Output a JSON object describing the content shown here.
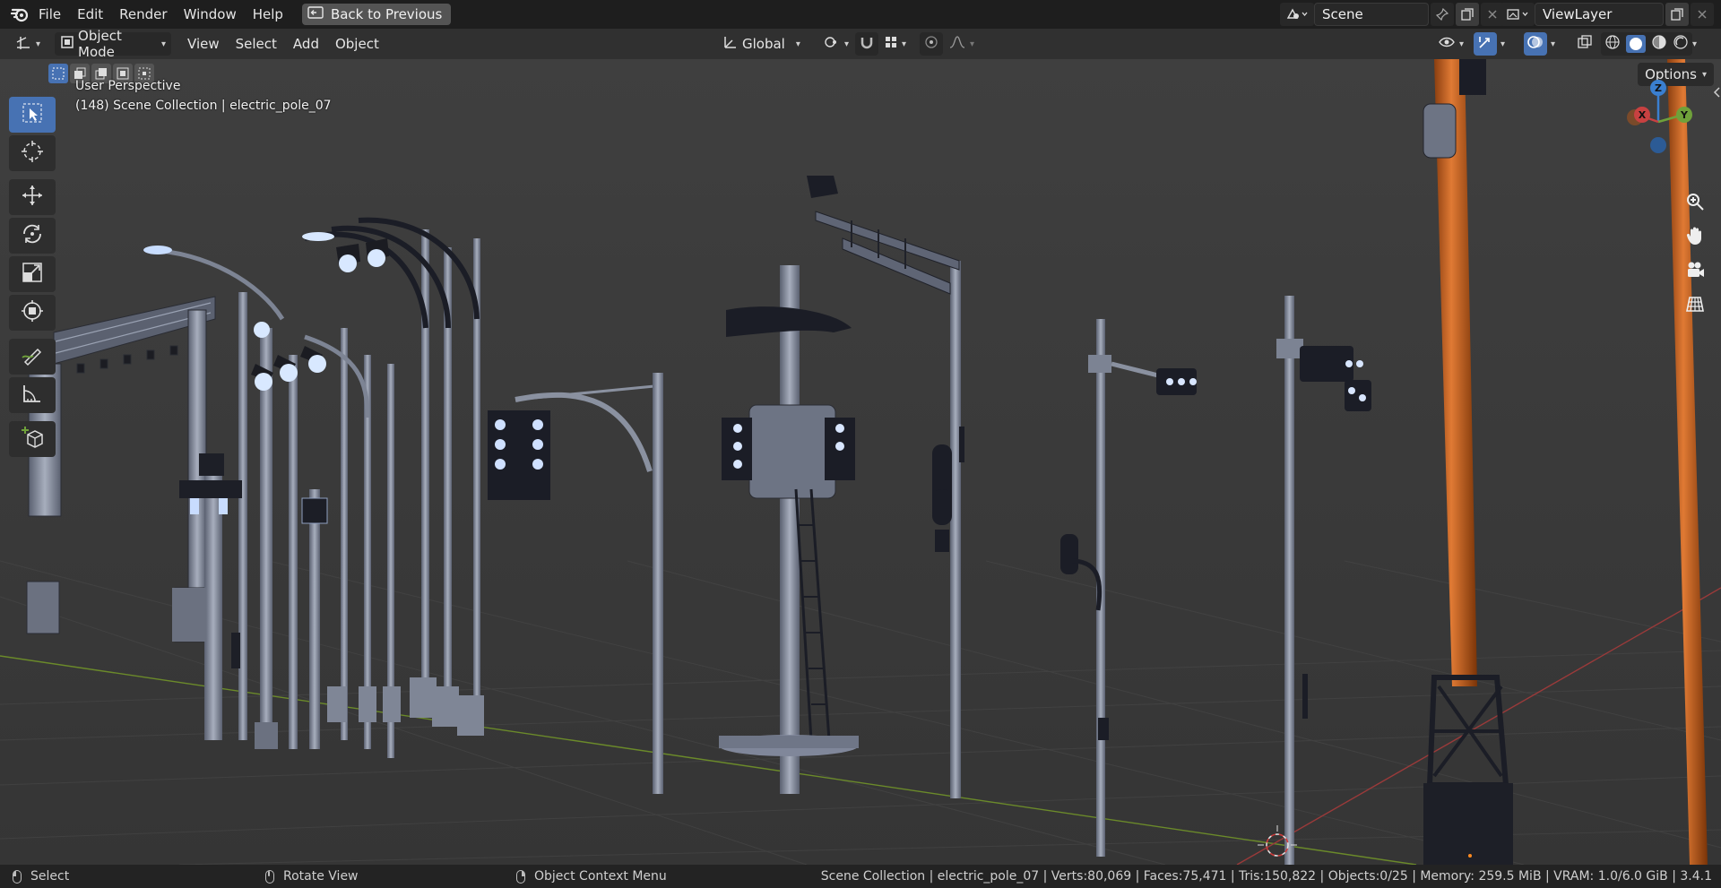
{
  "menu": {
    "file": "File",
    "edit": "Edit",
    "render": "Render",
    "window": "Window",
    "help": "Help",
    "back_button": "Back to Previous"
  },
  "scene": {
    "name": "Scene",
    "view_layer": "ViewLayer"
  },
  "header": {
    "mode": "Object Mode",
    "view": "View",
    "select": "Select",
    "add": "Add",
    "object": "Object",
    "orientation": "Global"
  },
  "viewport": {
    "perspective_label": "User Perspective",
    "collection_label": "(148) Scene Collection | electric_pole_07",
    "options_label": "Options",
    "gizmo": {
      "z": "Z",
      "y": "Y",
      "x": "X"
    }
  },
  "statusbar": {
    "left_click": "Select",
    "middle_click": "Rotate View",
    "right_click": "Object Context Menu",
    "stats": "Scene Collection | electric_pole_07 | Verts:80,069 | Faces:75,471 | Tris:150,822 | Objects:0/25 | Memory: 259.5 MiB | VRAM: 1.0/6.0 GiB | 3.4.1"
  },
  "colors": {
    "accent": "#4772b3",
    "axis_x": "#c84141",
    "axis_y": "#6fa13a",
    "axis_z": "#3a7fd0",
    "pole_orange": "#d0621c",
    "viewport_bg": "#3d3d3d"
  },
  "icons": {
    "toolbar": [
      "select-box-icon",
      "cursor-icon",
      "move-icon",
      "rotate-icon",
      "scale-icon",
      "transform-icon",
      "annotate-icon",
      "measure-icon",
      "add-cube-icon"
    ],
    "nav": [
      "zoom-icon",
      "hand-icon",
      "camera-icon",
      "grid-icon"
    ]
  }
}
